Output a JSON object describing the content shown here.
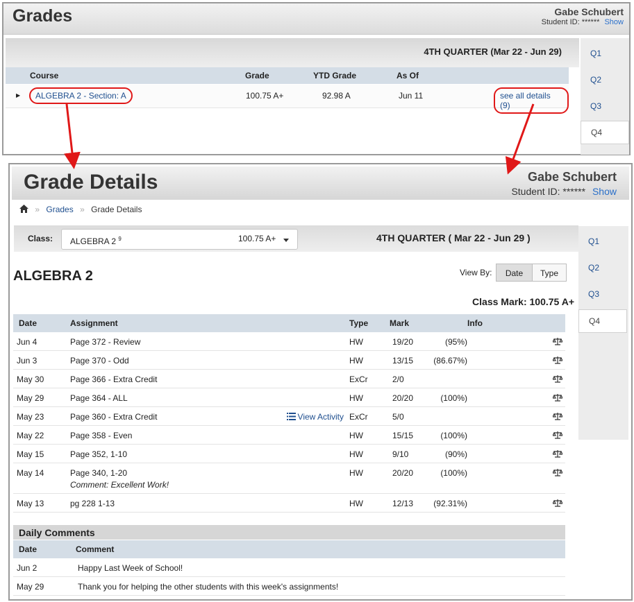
{
  "grades": {
    "title": "Grades",
    "student_name": "Gabe Schubert",
    "student_id_label": "Student ID:",
    "student_id_value": "******",
    "show_label": "Show",
    "quarter": "4TH QUARTER (Mar 22 - Jun 29)",
    "columns": [
      "Course",
      "Grade",
      "YTD Grade",
      "As Of"
    ],
    "row": {
      "course": "ALGEBRA 2 - Section: A",
      "grade": "100.75 A+",
      "ytd": "92.98 A",
      "as_of": "Jun 11",
      "details": "see all details (9)"
    },
    "tabs": [
      "Q1",
      "Q2",
      "Q3",
      "Q4"
    ],
    "active_tab": "Q4"
  },
  "details": {
    "title": "Grade Details",
    "student_name": "Gabe Schubert",
    "student_id_label": "Student ID:",
    "student_id_value": "******",
    "show_label": "Show",
    "breadcrumb": [
      "Grades",
      "Grade Details"
    ],
    "class_label": "Class:",
    "class_name": "ALGEBRA 2",
    "class_sup": "9",
    "class_mark": "100.75 A+",
    "quarter": "4TH QUARTER ( Mar 22 - Jun 29 )",
    "heading": "ALGEBRA 2",
    "view_by_label": "View By:",
    "view_by_options": [
      "Date",
      "Type"
    ],
    "view_by_selected": "Date",
    "class_mark_label": "Class Mark: 100.75 A+",
    "columns": [
      "Date",
      "Assignment",
      "Type",
      "Mark",
      "Info"
    ],
    "assignments": [
      {
        "date": "Jun 4",
        "name": "Page 372 - Review",
        "type": "HW",
        "mark": "19/20",
        "pct": "(95%)"
      },
      {
        "date": "Jun 3",
        "name": "Page 370 - Odd",
        "type": "HW",
        "mark": "13/15",
        "pct": "(86.67%)"
      },
      {
        "date": "May 30",
        "name": "Page 366 - Extra Credit",
        "type": "ExCr",
        "mark": "2/0",
        "pct": ""
      },
      {
        "date": "May 29",
        "name": "Page 364 - ALL",
        "type": "HW",
        "mark": "20/20",
        "pct": "(100%)"
      },
      {
        "date": "May 23",
        "name": "Page 360 - Extra Credit",
        "type": "ExCr",
        "mark": "5/0",
        "pct": "",
        "action": "View Activity"
      },
      {
        "date": "May 22",
        "name": "Page 358 - Even",
        "type": "HW",
        "mark": "15/15",
        "pct": "(100%)"
      },
      {
        "date": "May 15",
        "name": "Page 352, 1-10",
        "type": "HW",
        "mark": "9/10",
        "pct": "(90%)"
      },
      {
        "date": "May 14",
        "name": "Page 340, 1-20",
        "type": "HW",
        "mark": "20/20",
        "pct": "(100%)",
        "comment": "Comment: Excellent Work!"
      },
      {
        "date": "May 13",
        "name": "pg 228 1-13",
        "type": "HW",
        "mark": "12/13",
        "pct": "(92.31%)"
      }
    ],
    "daily_comments_title": "Daily Comments",
    "daily_columns": [
      "Date",
      "Comment"
    ],
    "daily_comments": [
      {
        "date": "Jun 2",
        "comment": "Happy Last Week of School!"
      },
      {
        "date": "May 29",
        "comment": "Thank you for helping the other students with this week's assignments!"
      }
    ],
    "tabs": [
      "Q1",
      "Q2",
      "Q3",
      "Q4"
    ],
    "active_tab": "Q4"
  },
  "colors": {
    "annotation_red": "#e01818",
    "link_blue": "#1f4f8f",
    "header_row_bg": "#d4dde6"
  }
}
